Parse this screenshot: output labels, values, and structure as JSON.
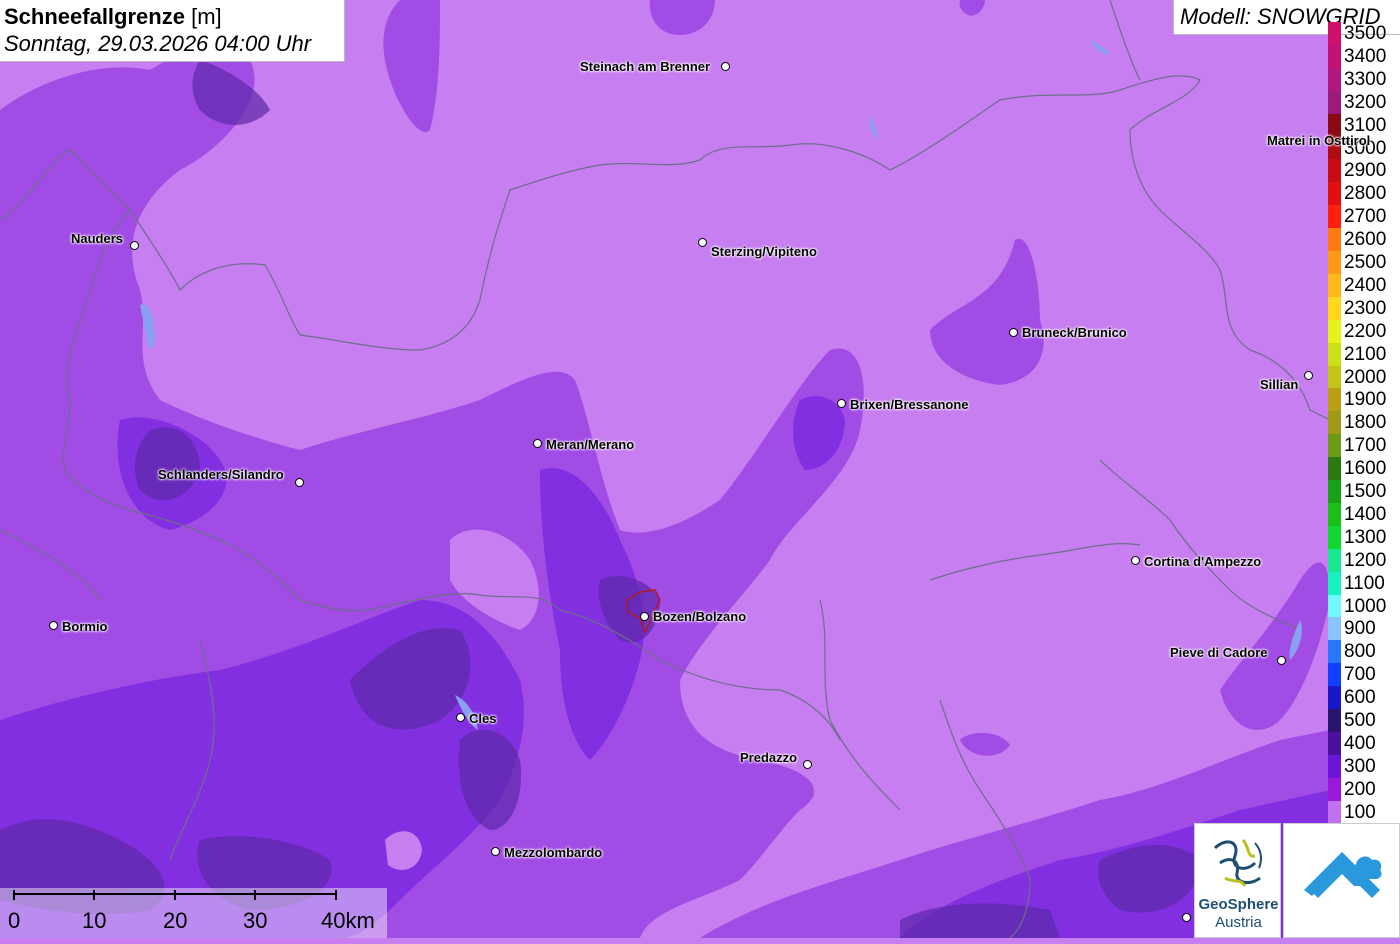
{
  "header": {
    "title": "Schneefallgrenze",
    "unit": "[m]",
    "date": "Sonntag, 29.03.2026 04:00 Uhr"
  },
  "model_label": "Modell: SNOWGRID",
  "legend": {
    "items": [
      {
        "label": "3500",
        "color": "#d0106a"
      },
      {
        "label": "3400",
        "color": "#c21276"
      },
      {
        "label": "3300",
        "color": "#b01880"
      },
      {
        "label": "3200",
        "color": "#9c1a78"
      },
      {
        "label": "3100",
        "color": "#8a0a14"
      },
      {
        "label": "3000",
        "color": "#b00a14"
      },
      {
        "label": "2900",
        "color": "#c80c14"
      },
      {
        "label": "2800",
        "color": "#e01010"
      },
      {
        "label": "2700",
        "color": "#ff2010"
      },
      {
        "label": "2600",
        "color": "#ff7a10"
      },
      {
        "label": "2500",
        "color": "#ff9a18"
      },
      {
        "label": "2400",
        "color": "#ffb818"
      },
      {
        "label": "2300",
        "color": "#ffd81a"
      },
      {
        "label": "2200",
        "color": "#e6f21a"
      },
      {
        "label": "2100",
        "color": "#cce016"
      },
      {
        "label": "2000",
        "color": "#c2c416"
      },
      {
        "label": "1900",
        "color": "#b8a012"
      },
      {
        "label": "1800",
        "color": "#a09a16"
      },
      {
        "label": "1700",
        "color": "#6a9a18"
      },
      {
        "label": "1600",
        "color": "#2a7a10"
      },
      {
        "label": "1500",
        "color": "#18a018"
      },
      {
        "label": "1400",
        "color": "#18c018"
      },
      {
        "label": "1300",
        "color": "#10d830"
      },
      {
        "label": "1200",
        "color": "#18e890"
      },
      {
        "label": "1100",
        "color": "#18f0c0"
      },
      {
        "label": "1000",
        "color": "#70f8ff"
      },
      {
        "label": "900",
        "color": "#8ac4ff"
      },
      {
        "label": "800",
        "color": "#2878ff"
      },
      {
        "label": "700",
        "color": "#1040ff"
      },
      {
        "label": "600",
        "color": "#1818c8"
      },
      {
        "label": "500",
        "color": "#2a1470"
      },
      {
        "label": "400",
        "color": "#4a10a0"
      },
      {
        "label": "300",
        "color": "#6a14d8"
      },
      {
        "label": "200",
        "color": "#9a18d8"
      },
      {
        "label": "100",
        "color": "#c070f0"
      }
    ]
  },
  "cities": [
    {
      "name": "Steinach am Brenner"
    },
    {
      "name": "Matrei in Osttirol"
    },
    {
      "name": "Nauders"
    },
    {
      "name": "Sterzing/Vipiteno"
    },
    {
      "name": "Bruneck/Brunico"
    },
    {
      "name": "Sillian"
    },
    {
      "name": "Brixen/Bressanone"
    },
    {
      "name": "Meran/Merano"
    },
    {
      "name": "Schlanders/Silandro"
    },
    {
      "name": "Cortina d'Ampezzo"
    },
    {
      "name": "Bozen/Bolzano"
    },
    {
      "name": "Bormio"
    },
    {
      "name": "Pieve di Cadore"
    },
    {
      "name": "Cles"
    },
    {
      "name": "Predazzo"
    },
    {
      "name": "Mezzolombardo"
    }
  ],
  "scale_bar": {
    "labels": [
      "0",
      "10",
      "20",
      "30",
      "40km"
    ]
  },
  "logos": {
    "geosphere_line1": "GeoSphere",
    "geosphere_line2": "Austria"
  },
  "colors": {
    "base_100": "#c67ef0",
    "band_200": "#a24ce6",
    "band_300": "#7c2ae0",
    "band_400": "#5d2aa8",
    "border": "#6b6f8a"
  }
}
